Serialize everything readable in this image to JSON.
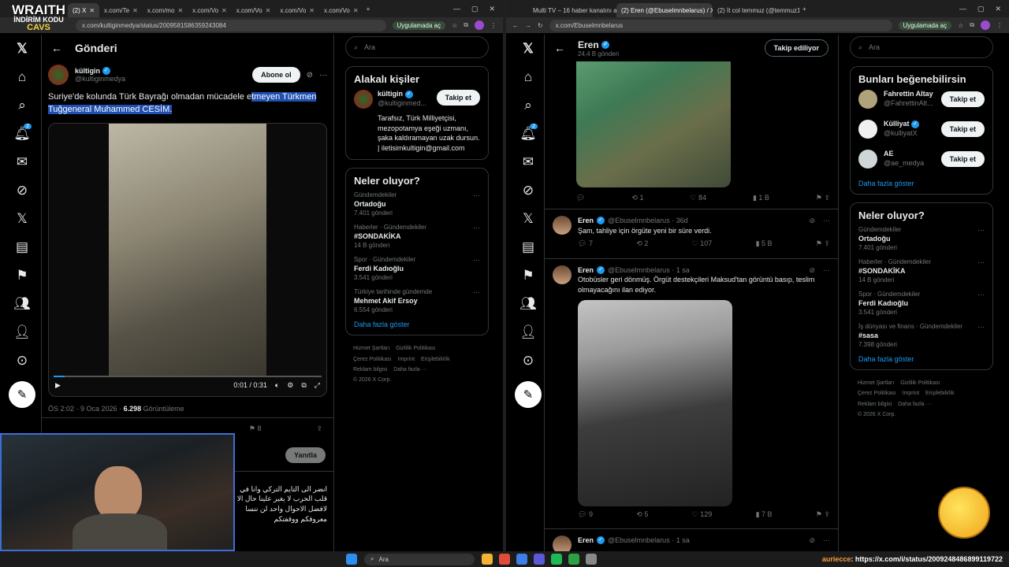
{
  "overlay": {
    "brand_line1": "WRAITH",
    "brand_line2": "İNDİRİM KODU",
    "brand_line3": "CAVS"
  },
  "left": {
    "tabs": [
      {
        "label": "(2) X",
        "active": true
      },
      {
        "label": "x.com/Te"
      },
      {
        "label": "x.com/mo"
      },
      {
        "label": "x.com/Vo"
      },
      {
        "label": "x.com/Vo"
      },
      {
        "label": "x.com/Vo"
      },
      {
        "label": "x.com/Vo"
      }
    ],
    "url": "x.com/kultiginmedya/status/2009581586359243084",
    "app_pill": "Uygulamada aç",
    "header_title": "Gönderi",
    "post": {
      "author": "kültigin",
      "handle": "@kultiginmedya",
      "subscribe": "Abone ol",
      "text_plain": "Suriye'de kolunda Türk Bayrağı olmadan mücadele e",
      "text_selected": "tmeyen Türkmen Tuğgeneral Muhammed CESİM.",
      "time": "0:01 / 0:31",
      "timestamp": "ÖS 2:02 · 9 Oca 2026 ·",
      "views_count": "6.298",
      "views_label": "Görüntüleme",
      "bookmarks": "8",
      "reply_button": "Yanıtla",
      "arabic_reply": "انضر الى التايم التركي وانا في قلب الحرب لا يغير علينا حال الا لافضل الاحوال واحد لن ننسا معروفكم ووقفتكم"
    },
    "search_placeholder": "Ara",
    "related": {
      "title": "Alakalı kişiler",
      "name": "kültigin",
      "handle": "@kultiginmed...",
      "follow": "Takip et",
      "bio": "Tarafsız, Türk Milliyetçisi, mezopotamya eşeği uzmanı, şaka kaldıramayan uzak dursun. | iletisimkultigin@gmail.com"
    },
    "trends": {
      "title": "Neler oluyor?",
      "items": [
        {
          "meta": "Gündemdekiler",
          "name": "Ortadoğu",
          "count": "7.401 gönderi"
        },
        {
          "meta": "Haberler · Gündemdekiler",
          "name": "#SONDAKİKA",
          "count": "14 B gönderi"
        },
        {
          "meta": "Spor · Gündemdekiler",
          "name": "Ferdi Kadıoğlu",
          "count": "3.541 gönderi"
        },
        {
          "meta": "Türkiye tarihinde gündemde",
          "name": "Mehmet Akif Ersoy",
          "count": "6.554 gönderi"
        }
      ],
      "more": "Daha fazla göster"
    },
    "footer": [
      "Hizmet Şartları",
      "Gizlilik Politikası",
      "Çerez Politikası",
      "Imprint",
      "Erişilebilirlik",
      "Reklam bilgisi",
      "Daha fazla ···",
      "© 2026 X Corp."
    ]
  },
  "right": {
    "tabs": [
      {
        "label": "Multi TV – 16 haber kanalını aynı"
      },
      {
        "label": "(2) Eren (@Ebuselmnbelarus) / X",
        "active": true
      },
      {
        "label": "(2) İt col temmuz (@temmuz1)"
      }
    ],
    "url": "x.com/Ebuselmnbelarus",
    "app_pill": "Uygulamada aç",
    "profile_name": "Eren",
    "profile_posts": "24,4 B gönderi",
    "following_btn": "Takip ediliyor",
    "tweet0_actions": {
      "replies": "",
      "retweets": "1",
      "likes": "84",
      "views": "1 B"
    },
    "tweets": [
      {
        "name": "Eren",
        "handle": "@Ebuselmnbelarus · 36d",
        "text": "Şam, tahliye için örgüte yeni bir süre verdi.",
        "replies": "7",
        "retweets": "2",
        "likes": "107",
        "views": "5 B"
      },
      {
        "name": "Eren",
        "handle": "@Ebuselmnbelarus · 1 sa",
        "text": "Otobüsler geri dönmüş. Örgüt destekçileri Maksud'tan görüntü basıp, teslim olmayacağını ilan ediyor.",
        "replies": "9",
        "retweets": "5",
        "likes": "129",
        "views": "7 B"
      },
      {
        "name": "Eren",
        "handle": "@Ebuselmnbelarus · 1 sa",
        "text": ""
      }
    ],
    "suggestions": {
      "title": "Bunları beğenebilirsin",
      "people": [
        {
          "name": "Fahrettin Altay",
          "handle": "@FahrettinAlt...",
          "follow": "Takip et"
        },
        {
          "name": "Külliyat",
          "handle": "@kulliyatX",
          "follow": "Takip et"
        },
        {
          "name": "AE",
          "handle": "@ae_medya",
          "follow": "Takip et"
        }
      ],
      "more": "Daha fazla göster"
    },
    "trends": {
      "title": "Neler oluyor?",
      "items": [
        {
          "meta": "Gündemdekiler",
          "name": "Ortadoğu",
          "count": "7.401 gönderi"
        },
        {
          "meta": "Haberler · Gündemdekiler",
          "name": "#SONDAKİKA",
          "count": "14 B gönderi"
        },
        {
          "meta": "Spor · Gündemdekiler",
          "name": "Ferdi Kadıoğlu",
          "count": "3.541 gönderi"
        },
        {
          "meta": "İş dünyası ve finans · Gündemdekiler",
          "name": "#sasa",
          "count": "7.398 gönderi"
        }
      ],
      "more": "Daha fazla göster"
    },
    "footer": [
      "Hizmet Şartları",
      "Gizlilik Politikası",
      "Çerez Politikası",
      "Imprint",
      "Erişilebilirlik",
      "Reklam bilgisi",
      "Daha fazla ···",
      "© 2026 X Corp."
    ]
  },
  "taskbar": {
    "search": "Ara",
    "chat_user": "auriecce",
    "chat_text": ": https://x.com/i/status/2009248486899119722"
  }
}
